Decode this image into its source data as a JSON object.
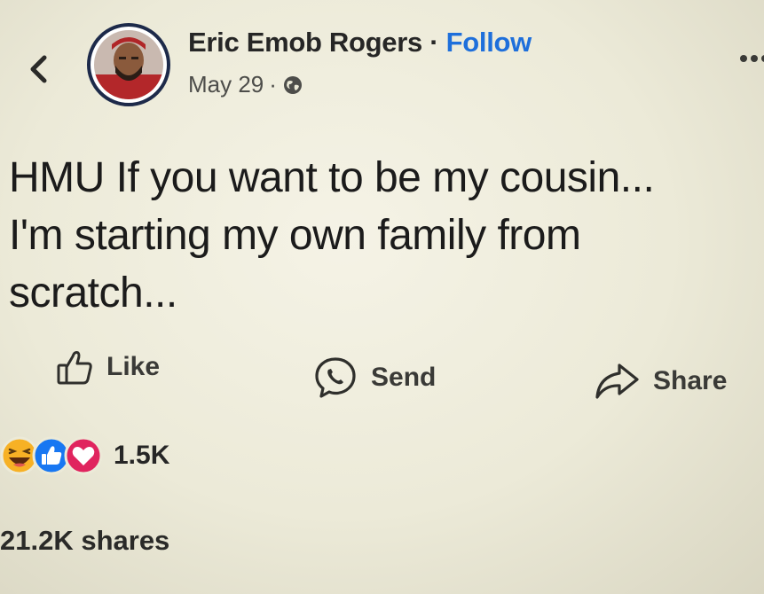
{
  "header": {
    "back_icon": "chevron-left-icon",
    "author_name": "Eric Emob Rogers",
    "separator": "·",
    "follow_label": "Follow",
    "date": "May 29",
    "date_separator": "·",
    "privacy_icon": "globe-icon",
    "more_icon": "more-dots-icon"
  },
  "post": {
    "text": "HMU If you want to be my cousin...\nI'm starting my own family from\nscratch..."
  },
  "actions": {
    "like": {
      "label": "Like",
      "icon": "thumbs-up-icon"
    },
    "send": {
      "label": "Send",
      "icon": "messenger-icon"
    },
    "share": {
      "label": "Share",
      "icon": "share-arrow-icon"
    }
  },
  "engagement": {
    "reaction_icons": [
      "haha-reaction-icon",
      "like-reaction-icon",
      "love-reaction-icon"
    ],
    "reaction_count": "1.5K",
    "shares": "21.2K shares"
  },
  "colors": {
    "follow_link": "#1e6fdb",
    "like_reaction": "#1877f2",
    "love_reaction": "#e0245e",
    "haha_reaction": "#f7b125",
    "avatar_ring": "#1d2a4a"
  }
}
